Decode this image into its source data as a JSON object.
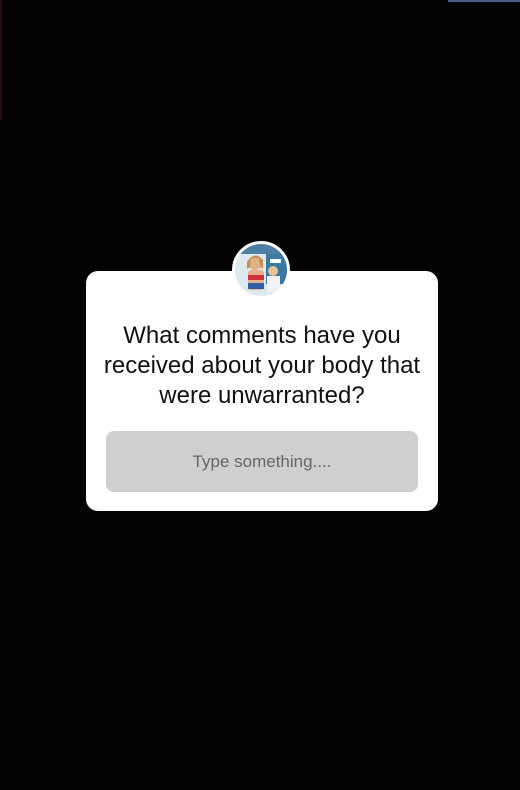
{
  "story": {
    "question_sticker": {
      "avatar_icon": "profile-photo-icon",
      "question": "What comments have you received about your body that were unwarranted?",
      "input_placeholder": "Type something...."
    }
  },
  "colors": {
    "background": "#020202",
    "card": "#ffffff",
    "input_fill": "#cfcfcf",
    "text": "#111111",
    "placeholder": "#666666"
  }
}
